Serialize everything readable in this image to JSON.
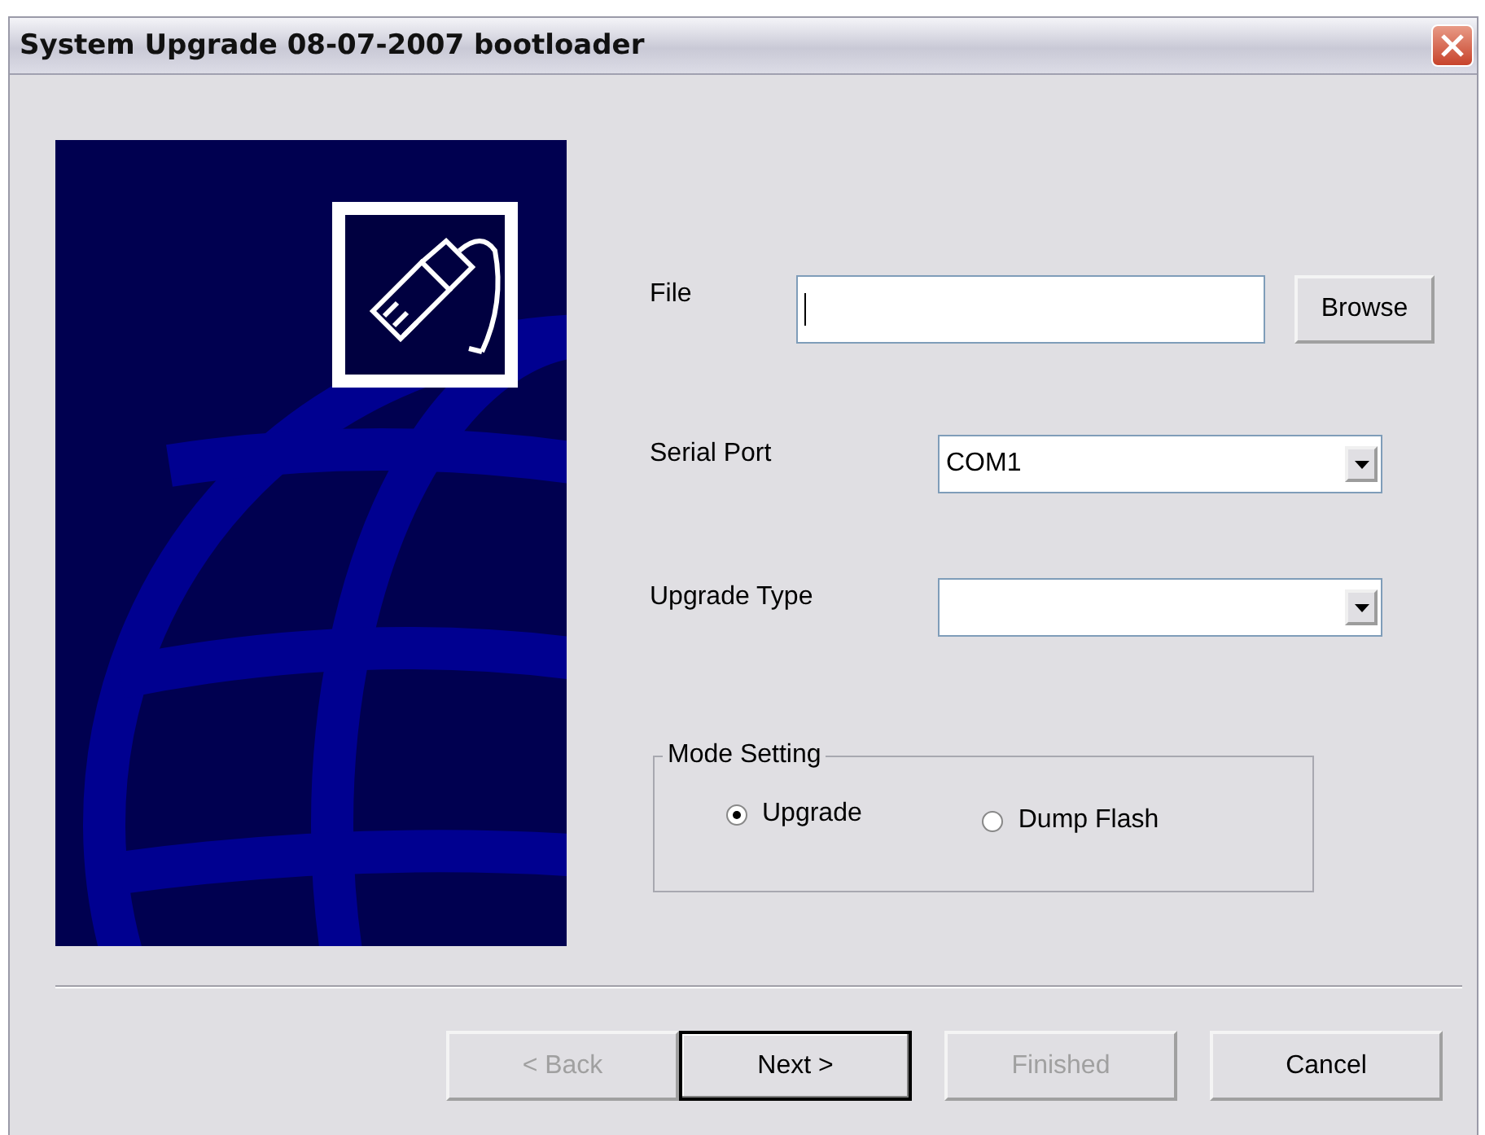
{
  "window": {
    "title": "System Upgrade 08-07-2007 bootloader"
  },
  "fields": [
    {
      "kind": "text",
      "label": "File",
      "button": "Browse"
    },
    {
      "kind": "combo",
      "label": "Serial Port",
      "value": "COM1"
    },
    {
      "kind": "combo",
      "label": "Upgrade Type"
    }
  ],
  "mode_setting": {
    "title": "Mode Setting",
    "options": [
      {
        "label": "Upgrade",
        "selected": true
      },
      {
        "label": "Dump Flash",
        "selected": false
      }
    ]
  },
  "buttons": [
    {
      "label": "< Back",
      "disabled": true,
      "default": false
    },
    {
      "label": "Next >",
      "disabled": false,
      "default": true
    },
    {
      "label": "Finished",
      "disabled": true,
      "default": false
    },
    {
      "label": "Cancel",
      "disabled": false,
      "default": false
    }
  ]
}
